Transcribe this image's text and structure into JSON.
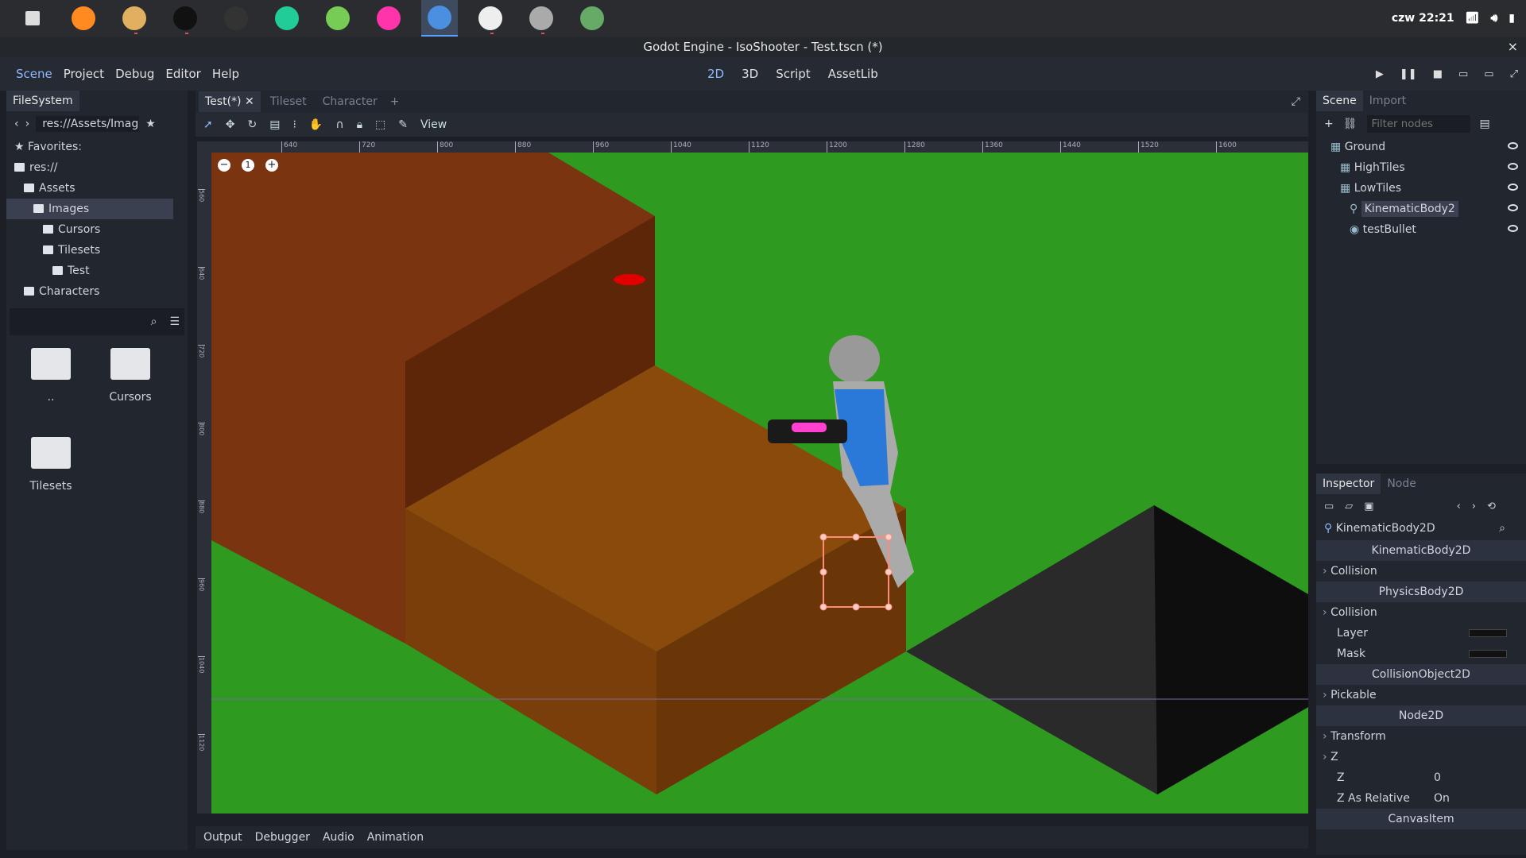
{
  "taskbar": {
    "apps": [
      {
        "icon": "grid-menu-icon"
      },
      {
        "icon": "firefox-icon"
      },
      {
        "icon": "file-manager-icon"
      },
      {
        "icon": "terminal-icon"
      },
      {
        "icon": "steam-icon"
      },
      {
        "icon": "atom-icon"
      },
      {
        "icon": "android-studio-icon"
      },
      {
        "icon": "jetbrains-icon"
      },
      {
        "icon": "godot-icon"
      },
      {
        "icon": "text-editor-icon"
      },
      {
        "icon": "gimp-icon"
      },
      {
        "icon": "calculator-icon"
      }
    ],
    "clock": "czw 22:21"
  },
  "window": {
    "title": "Godot Engine - IsoShooter - Test.tscn (*)",
    "close": "×"
  },
  "menu": {
    "items": [
      "Scene",
      "Project",
      "Debug",
      "Editor",
      "Help"
    ],
    "modes": [
      "2D",
      "3D",
      "Script",
      "AssetLib"
    ]
  },
  "filesystem": {
    "tab": "FileSystem",
    "path": "res://Assets/Imag",
    "tree": [
      {
        "label": "Favorites:",
        "depth": 0
      },
      {
        "label": "res://",
        "depth": 0
      },
      {
        "label": "Assets",
        "depth": 1
      },
      {
        "label": "Images",
        "depth": 2
      },
      {
        "label": "Cursors",
        "depth": 3
      },
      {
        "label": "Tilesets",
        "depth": 3
      },
      {
        "label": "Test",
        "depth": 4
      },
      {
        "label": "Characters",
        "depth": 1
      }
    ],
    "items": [
      "..",
      "Cursors",
      "Tilesets"
    ]
  },
  "editor": {
    "tabs": [
      "Test(*)",
      "Tileset",
      "Character"
    ],
    "view_label": "View",
    "ruler_ticks": [
      "640",
      "720",
      "800",
      "880",
      "960",
      "1040",
      "1120",
      "1200",
      "1280",
      "1360",
      "1440",
      "1520",
      "1600"
    ],
    "ruler_v_ticks": [
      "560",
      "640",
      "720",
      "800",
      "880",
      "960",
      "1040",
      "1120"
    ],
    "zoom_reset": "1"
  },
  "bottom": {
    "tabs": [
      "Output",
      "Debugger",
      "Audio",
      "Animation"
    ]
  },
  "scene": {
    "tabs": [
      "Scene",
      "Import"
    ],
    "filter_placeholder": "Filter nodes",
    "nodes": [
      {
        "label": "Ground",
        "depth": 0
      },
      {
        "label": "HighTiles",
        "depth": 1
      },
      {
        "label": "LowTiles",
        "depth": 1
      },
      {
        "label": "KinematicBody2",
        "depth": 2
      },
      {
        "label": "testBullet",
        "depth": 2
      }
    ]
  },
  "inspector": {
    "tabs": [
      "Inspector",
      "Node"
    ],
    "object": "KinematicBody2D",
    "rows": [
      {
        "label": "KinematicBody2D",
        "type": "class"
      },
      {
        "label": "Collision",
        "type": "group"
      },
      {
        "label": "PhysicsBody2D",
        "type": "class"
      },
      {
        "label": "Collision",
        "type": "group"
      },
      {
        "label": "Layer",
        "type": "prop"
      },
      {
        "label": "Mask",
        "type": "prop"
      },
      {
        "label": "CollisionObject2D",
        "type": "class"
      },
      {
        "label": "Pickable",
        "type": "group"
      },
      {
        "label": "Node2D",
        "type": "class"
      },
      {
        "label": "Transform",
        "type": "group"
      },
      {
        "label": "Z",
        "type": "group"
      },
      {
        "label": "Z",
        "type": "prop",
        "value": "0"
      },
      {
        "label": "Z As Relative",
        "type": "prop",
        "value": "On"
      },
      {
        "label": "CanvasItem",
        "type": "class"
      }
    ]
  }
}
